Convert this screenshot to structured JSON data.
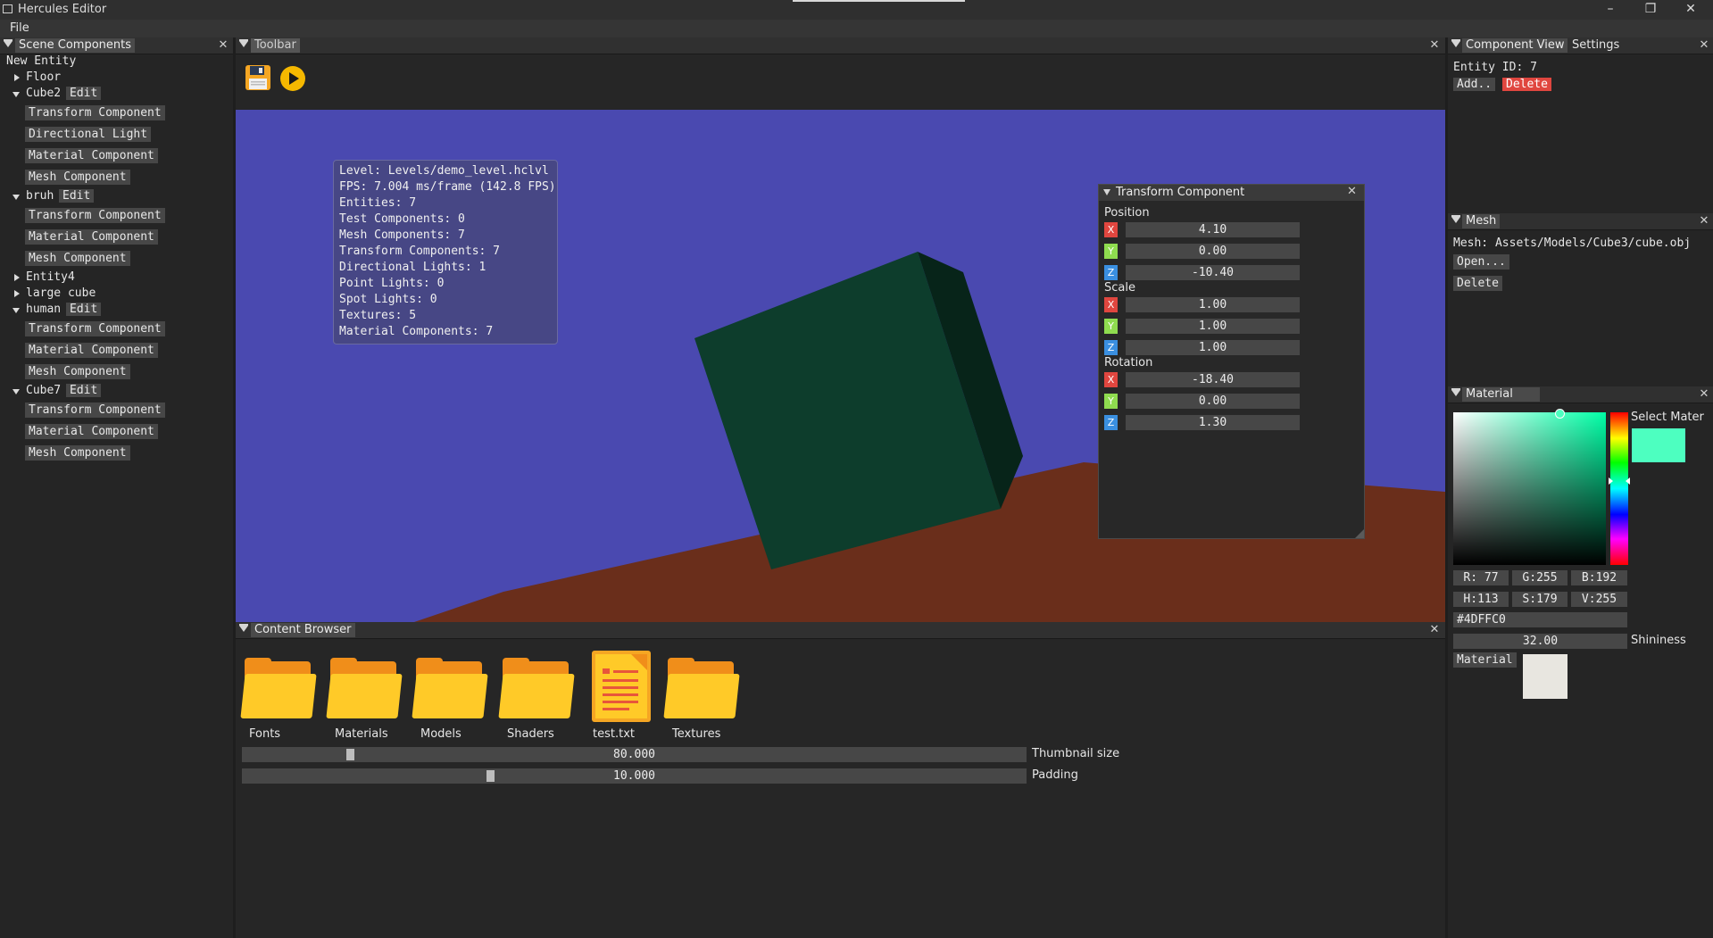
{
  "window": {
    "title": "Hercules Editor",
    "minimize": "–",
    "restore": "❐",
    "close": "✕"
  },
  "menu": {
    "file": "File"
  },
  "scene": {
    "tab": "Scene Components",
    "close": "✕",
    "new_entity": "New Entity",
    "edit_label": "Edit",
    "entities": [
      {
        "name": "Floor"
      },
      {
        "name": "Cube2",
        "components": [
          "Transform Component",
          "Directional Light",
          "Material Component",
          "Mesh Component"
        ]
      },
      {
        "name": "bruh",
        "components": [
          "Transform Component",
          "Material Component",
          "Mesh Component"
        ]
      },
      {
        "name": "Entity4"
      },
      {
        "name": "large cube"
      },
      {
        "name": "human",
        "components": [
          "Transform Component",
          "Material Component",
          "Mesh Component"
        ]
      },
      {
        "name": "Cube7",
        "components": [
          "Transform Component",
          "Material Component",
          "Mesh Component"
        ]
      }
    ]
  },
  "toolbar": {
    "tab": "Toolbar",
    "close": "✕"
  },
  "viewport": {
    "colors": {
      "sky": "#4a49b0",
      "floor": "#6a2e1b",
      "cube_front": "#0d3d2c",
      "cube_side": "#072419"
    },
    "stats": [
      "Level: Levels/demo_level.hclvl",
      "FPS: 7.004 ms/frame (142.8 FPS)",
      "Entities: 7",
      "Test Components: 0",
      "Mesh Components: 7",
      "Transform Components: 7",
      "Directional Lights: 1",
      "Point Lights: 0",
      "Spot Lights: 0",
      "Textures: 5",
      "Material Components: 7"
    ]
  },
  "transform": {
    "title": "Transform Component",
    "close": "✕",
    "position_label": "Position",
    "scale_label": "Scale",
    "rotation_label": "Rotation",
    "axes": [
      "X",
      "Y",
      "Z"
    ],
    "position": [
      "4.10",
      "0.00",
      "-10.40"
    ],
    "scale": [
      "1.00",
      "1.00",
      "1.00"
    ],
    "rotation": [
      "-18.40",
      "0.00",
      "1.30"
    ]
  },
  "content_browser": {
    "tab": "Content Browser",
    "close": "✕",
    "items": [
      {
        "name": "Fonts",
        "icon": "folder-icon"
      },
      {
        "name": "Materials",
        "icon": "folder-icon"
      },
      {
        "name": "Models",
        "icon": "folder-icon"
      },
      {
        "name": "Shaders",
        "icon": "folder-icon"
      },
      {
        "name": "test.txt",
        "icon": "text-file-icon"
      },
      {
        "name": "Textures",
        "icon": "folder-icon"
      }
    ],
    "thumbnail_size": {
      "label": "Thumbnail size",
      "value": "80.000",
      "fraction": 0.135
    },
    "padding": {
      "label": "Padding",
      "value": "10.000",
      "fraction": 0.315
    }
  },
  "component_view": {
    "tab": "Component View",
    "settings_tab": "Settings",
    "close": "✕",
    "entity_id": "Entity ID: 7",
    "add": "Add..",
    "delete": "Delete"
  },
  "mesh": {
    "tab": "Mesh",
    "close": "✕",
    "path": "Mesh: Assets/Models/Cube3/cube.obj",
    "open": "Open...",
    "delete": "Delete"
  },
  "material": {
    "tab": "Material",
    "close": "✕",
    "select_label": "Select Mater",
    "selected_color": "#4DFFC0",
    "r": "R: 77",
    "g": "G:255",
    "b": "B:192",
    "h": "H:113",
    "s": "S:179",
    "v": "V:255",
    "hex": "#4DFFC0",
    "shininess_value": "32.00",
    "shininess_label": "Shininess",
    "material_button": "Material",
    "material_swatch": "#e8e6e0"
  }
}
